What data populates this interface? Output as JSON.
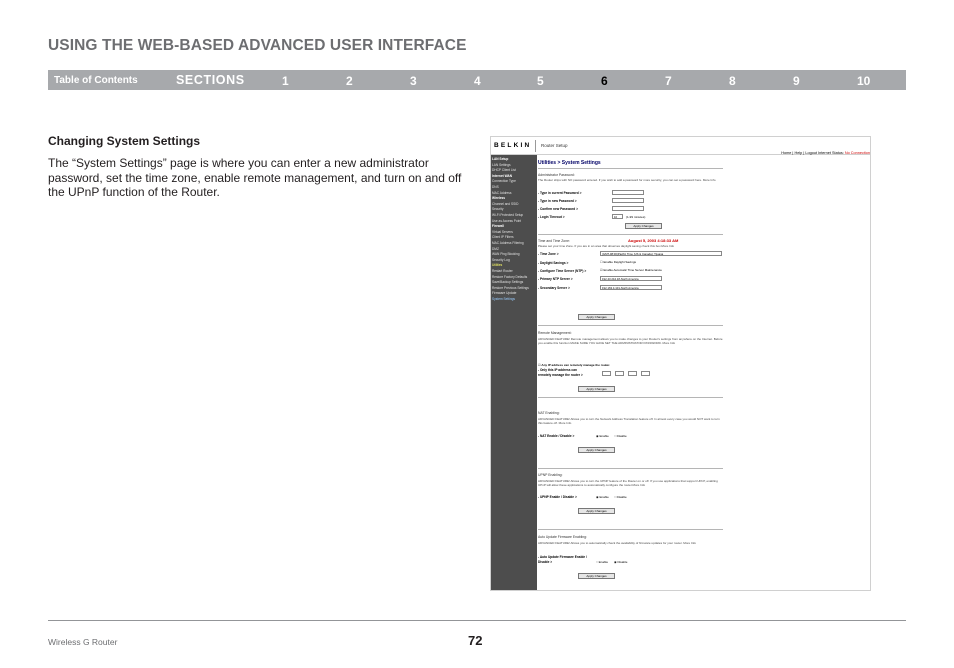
{
  "header": {
    "title": "USING THE WEB-BASED ADVANCED USER INTERFACE"
  },
  "nav": {
    "toc_label": "Table of Contents",
    "sections_label": "SECTIONS",
    "numbers": [
      "1",
      "2",
      "3",
      "4",
      "5",
      "6",
      "7",
      "8",
      "9",
      "10"
    ],
    "active": "6"
  },
  "content": {
    "heading": "Changing System Settings",
    "body": "The “System Settings” page is where you can enter a new administrator password, set the time zone, enable remote management, and turn on and off the UPnP function of the Router."
  },
  "screenshot": {
    "logo": "BELKIN",
    "router_setup": "Router Setup",
    "status_links": "Home | Help | Logout",
    "status_label": "Internet Status:",
    "status_value": "No Connection",
    "sidebar": [
      {
        "label": "LAN Setup",
        "kind": "head"
      },
      {
        "label": "LAN Settings",
        "kind": "item"
      },
      {
        "label": "DHCP Client List",
        "kind": "item"
      },
      {
        "label": "Internet WAN",
        "kind": "head"
      },
      {
        "label": "Connection Type",
        "kind": "item"
      },
      {
        "label": "DNS",
        "kind": "item"
      },
      {
        "label": "MAC Address",
        "kind": "item"
      },
      {
        "label": "Wireless",
        "kind": "head"
      },
      {
        "label": "Channel and SSID",
        "kind": "item"
      },
      {
        "label": "Security",
        "kind": "item"
      },
      {
        "label": "Wi-Fi Protected Setup",
        "kind": "item"
      },
      {
        "label": "Use as Access Point",
        "kind": "item"
      },
      {
        "label": "Firewall",
        "kind": "head"
      },
      {
        "label": "Virtual Servers",
        "kind": "item"
      },
      {
        "label": "Client IP Filters",
        "kind": "item"
      },
      {
        "label": "MAC Address Filtering",
        "kind": "item"
      },
      {
        "label": "DMZ",
        "kind": "item"
      },
      {
        "label": "WAN Ping Blocking",
        "kind": "item"
      },
      {
        "label": "Security Log",
        "kind": "item"
      },
      {
        "label": "Utilities",
        "kind": "hl"
      },
      {
        "label": "Restart Router",
        "kind": "item"
      },
      {
        "label": "Restore Factory Defaults",
        "kind": "item"
      },
      {
        "label": "Save/Backup Settings",
        "kind": "item"
      },
      {
        "label": "Restore Previous Settings",
        "kind": "item"
      },
      {
        "label": "Firmware Update",
        "kind": "item"
      },
      {
        "label": "System Settings",
        "kind": "sel"
      }
    ],
    "page_title": "Utilities > System Settings",
    "admin": {
      "heading": "Administrator Password:",
      "text": "The Router ships with NO password entered. If you wish to add a password for more security, you can set a password here. More Info",
      "current_label": "- Type in current Password >",
      "new_label": "- Type in new Password >",
      "confirm_label": "- Confirm new Password >",
      "timeout_label": "- Login Timeout >",
      "timeout_value": "10",
      "timeout_unit": "(1-99 minutes)",
      "apply": "Apply Changes"
    },
    "time": {
      "heading": "Time and Time Zone:",
      "current_time": "August 5, 2003 4:18:33 AM",
      "text": "Please set your time Zone. If you are in an area that observes daylight saving check this box.More Info",
      "zone_label": "- Time Zone >",
      "zone_value": "(GMT-08:00)Pacific Time (US & Canada); Tijuana",
      "dst_label": "- Daylight Savings >",
      "dst_value": "Enable Daylight Savings",
      "ntp_label": "- Configure Time Server (NTP) >",
      "ntp_value": "Enable Automatic Time Server Maintenance",
      "primary_label": "- Primary NTP Server >",
      "primary_value": "192.43.244.18-North America",
      "secondary_label": "- Secondary Server >",
      "secondary_value": "192.163.4.101-North America",
      "apply": "Apply Changes"
    },
    "remote": {
      "heading": "Remote Management:",
      "text": "ADVANCED FEATURE! Remote management allows you to make changes to your Router's settings from anywhere on the Internet. Before you enable this function MAKE SURE YOU HAVE SET THE ADMINISTRATOR PASSWORD. More Info",
      "any_ip": "Any IP address can remotely manage the router.",
      "only_ip_1": "- Only this IP address can",
      "only_ip_2": "remotely manage the router >",
      "apply": "Apply Changes"
    },
    "nat": {
      "heading": "NAT Enabling:",
      "text": "ADVANCED FEATURE! Allows you to turn the Network Address Translation feature off. In almost every case you would NOT want to turn this feature off. More Info",
      "label": "- NAT Enable / Disable >",
      "enable": "Enable",
      "disable": "Disable",
      "apply": "Apply Changes"
    },
    "upnp": {
      "heading": "UPNP Enabling:",
      "text": "ADVANCED FEATURE! Allows you to turn the UPNP feature of the Router on or off. If you use applications that support UPnP, enabling UPnP will allow these applications to automatically configure the router.More Info",
      "label": "- UPNP Enable / Disable >",
      "enable": "Enable",
      "disable": "Disable",
      "apply": "Apply Changes"
    },
    "firmware": {
      "heading": "Auto Update Firmware Enabling:",
      "text": "ADVANCED FEATURE! Allows you to automatically check the availability of firmware updates for your router. More Info",
      "label_1": "- Auto Update Firmware Enable /",
      "label_2": "Disable >",
      "enable": "Enable",
      "disable": "Disable",
      "apply": "Apply Changes"
    }
  },
  "footer": {
    "product": "Wireless G Router",
    "page": "72"
  },
  "colors": {
    "nav_bg": "#a7a9ac",
    "title_gray": "#6d6e71",
    "sidebar_bg": "#4d4d4d",
    "alert_red": "#cc0000"
  }
}
